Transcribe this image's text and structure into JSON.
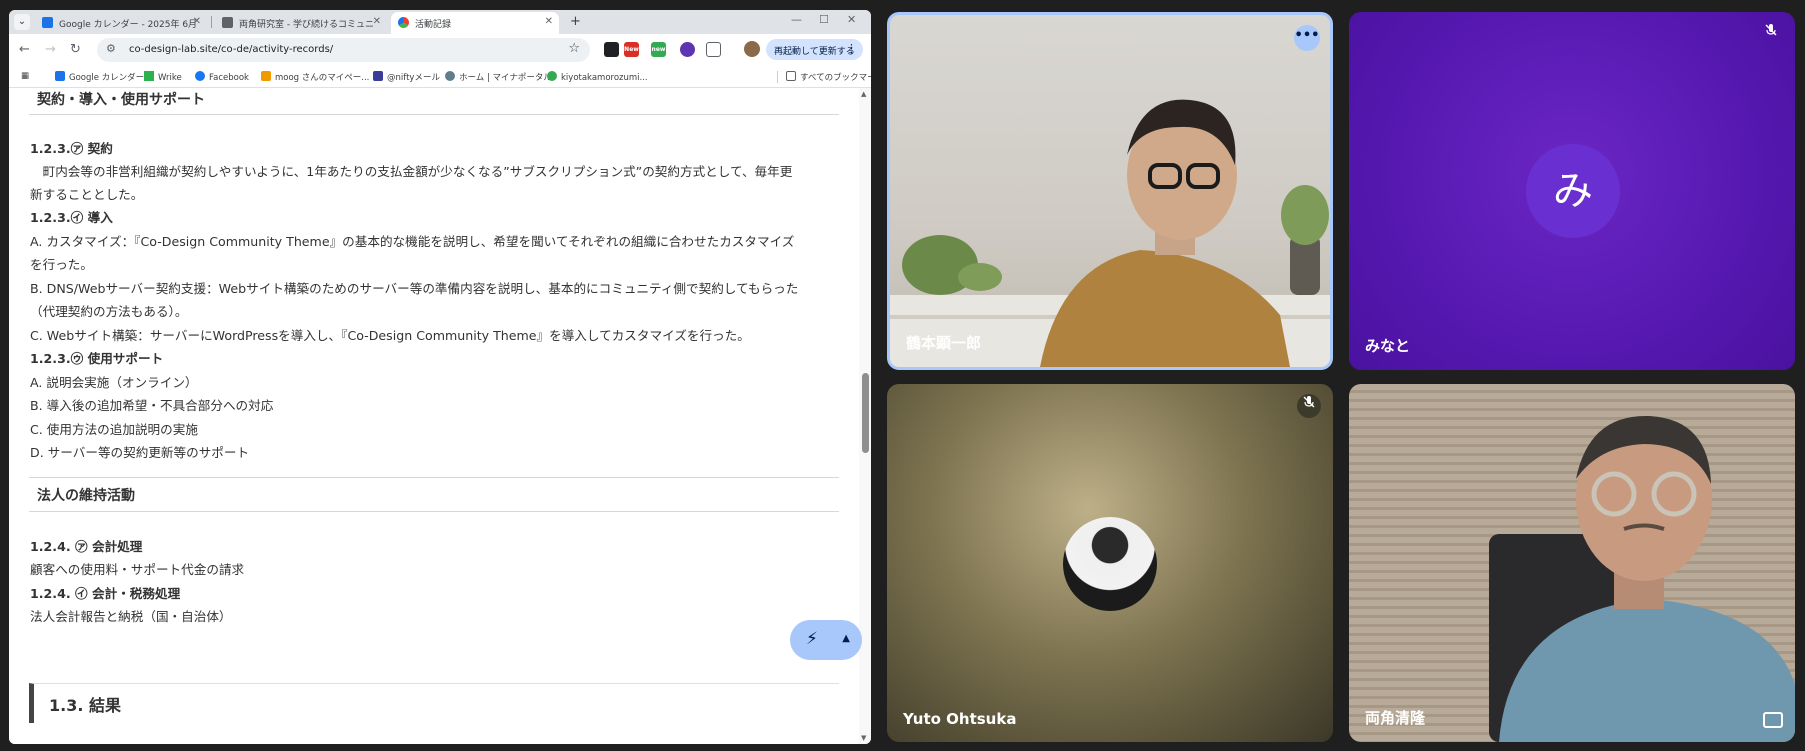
{
  "browser": {
    "tabs": [
      {
        "title": "Google カレンダー - 2025年 6月",
        "favicon_color": "#1a73e8"
      },
      {
        "title": "両角研究室 - 学び続けるコミュニ",
        "favicon_color": "#5f6368"
      },
      {
        "title": "活動記録",
        "favicon_color": "#4caf50"
      }
    ],
    "url": "co-design-lab.site/co-de/activity-records/",
    "update_button": "再起動して更新する",
    "bookmarks": [
      {
        "label": "Google カレンダー",
        "color": "#1a73e8"
      },
      {
        "label": "Wrike",
        "color": "#2bb24c"
      },
      {
        "label": "Facebook",
        "color": "#1877f2"
      },
      {
        "label": "moog さんのマイペー...",
        "color": "#f29900"
      },
      {
        "label": "@niftyメール",
        "color": "#3b3b98"
      },
      {
        "label": "ホーム | マイナポータル",
        "color": "#607d8b"
      },
      {
        "label": "kiyotakamorozumi...",
        "color": "#34a853"
      },
      {
        "label": "すべてのブックマーク",
        "color": "#5f6368"
      }
    ]
  },
  "content": {
    "section_top": "契約・導入・使用サポート",
    "lines": [
      {
        "text": "1.2.3.㋐ 契約",
        "bold": true
      },
      {
        "text": "　町内会等の非営利組織が契約しやすいように、1年あたりの支払金額が少なくなる”サブスクリプション式”の契約方式として、毎年更",
        "bold": false
      },
      {
        "text": "新することとした。",
        "bold": false
      },
      {
        "text": "1.2.3.㋑ 導入",
        "bold": true
      },
      {
        "text": "A. カスタマイズ：『Co-Design Community Theme』の基本的な機能を説明し、希望を聞いてそれぞれの組織に合わせたカスタマイズ",
        "bold": false
      },
      {
        "text": "を行った。",
        "bold": false
      },
      {
        "text": "B. DNS/Webサーバー契約支援：Webサイト構築のためのサーバー等の準備内容を説明し、基本的にコミュニティ側で契約してもらった",
        "bold": false
      },
      {
        "text": "（代理契約の方法もある）。",
        "bold": false
      },
      {
        "text": "C. Webサイト構築：サーバーにWordPressを導入し、『Co-Design Community Theme』を導入してカスタマイズを行った。",
        "bold": false
      },
      {
        "text": "1.2.3.㋒ 使用サポート",
        "bold": true
      },
      {
        "text": "A. 説明会実施（オンライン）",
        "bold": false
      },
      {
        "text": "B. 導入後の追加希望・不具合部分への対応",
        "bold": false
      },
      {
        "text": "C. 使用方法の追加説明の実施",
        "bold": false
      },
      {
        "text": "D. サーバー等の契約更新等のサポート",
        "bold": false
      }
    ],
    "section_maint": "法人の維持活動",
    "lines2": [
      {
        "text": "1.2.4. ㋐ 会計処理",
        "bold": true
      },
      {
        "text": "顧客への使用料・サポート代金の請求",
        "bold": false
      },
      {
        "text": "1.2.4. ㋑ 会計・税務処理",
        "bold": true
      },
      {
        "text": "法人会計報告と納税（国・自治体）",
        "bold": false
      }
    ],
    "result_heading": "1.3. 結果"
  },
  "meet": {
    "participants": [
      {
        "name": "鶴本顕一郎",
        "avatar": "",
        "muted": false
      },
      {
        "name": "みなと",
        "avatar": "み",
        "muted": true
      },
      {
        "name": "Yuto Ohtsuka",
        "avatar": "",
        "muted": true
      },
      {
        "name": "両角清隆",
        "avatar": "",
        "muted": false
      }
    ]
  },
  "icons": {
    "mic_off": "mic-off-icon",
    "more": "more-options-icon",
    "fullscreen": "fullscreen-icon"
  }
}
